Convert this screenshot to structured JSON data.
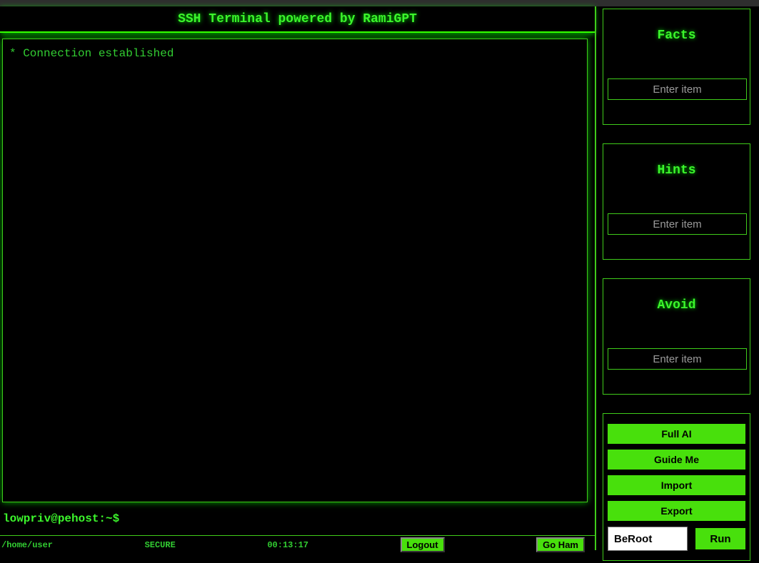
{
  "app": {
    "title": "SSH Terminal powered by RamiGPT"
  },
  "terminal": {
    "output_lines": [
      "* Connection established"
    ],
    "prompt": "lowpriv@pehost:~$"
  },
  "status_bar": {
    "path": "/home/user",
    "badge": "SECURE",
    "clock": "00:13:17",
    "logout_label": "Logout",
    "go_ham_label": "Go Ham"
  },
  "sidebar": {
    "panels": [
      {
        "title": "Facts",
        "input_placeholder": "Enter item"
      },
      {
        "title": "Hints",
        "input_placeholder": "Enter item"
      },
      {
        "title": "Avoid",
        "input_placeholder": "Enter item"
      }
    ],
    "actions": {
      "full_ai": "Full AI",
      "guide_me": "Guide Me",
      "import": "Import",
      "export": "Export",
      "script_value": "BeRoot",
      "run_label": "Run"
    }
  },
  "colors": {
    "background": "#000000",
    "top_strip_gray": "#2e2e2e",
    "accent_green": "#3cf52c",
    "line_green": "#33ff00",
    "border_green": "#3fcc1a",
    "button_green": "#48e00c",
    "terminal_text_green": "#32cd32",
    "placeholder_gray": "#9a9a9a"
  }
}
